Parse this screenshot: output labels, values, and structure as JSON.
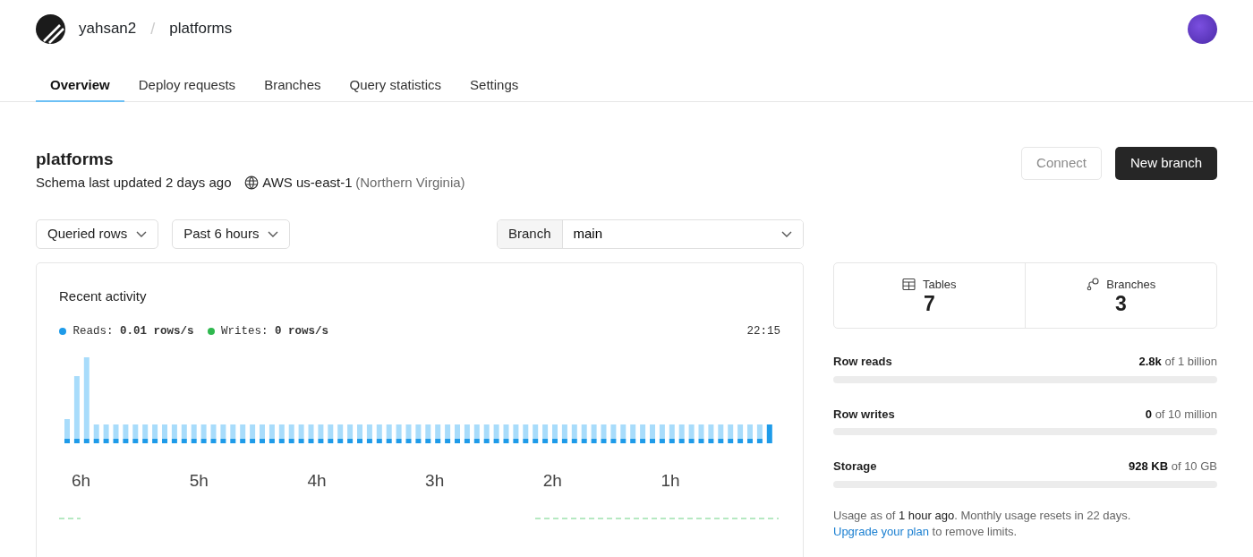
{
  "header": {
    "org": "yahsan2",
    "separator": "/",
    "database": "platforms"
  },
  "tabs": [
    {
      "label": "Overview",
      "selected": true
    },
    {
      "label": "Deploy requests",
      "selected": false
    },
    {
      "label": "Branches",
      "selected": false
    },
    {
      "label": "Query statistics",
      "selected": false
    },
    {
      "label": "Settings",
      "selected": false
    }
  ],
  "page": {
    "title": "platforms",
    "schema_updated": "Schema last updated 2 days ago",
    "region": "AWS us-east-1",
    "region_name": "(Northern Virginia)"
  },
  "actions": [
    {
      "label": "Connect",
      "kind": "secondary",
      "disabled": true
    },
    {
      "label": "New branch",
      "kind": "primary",
      "disabled": false
    }
  ],
  "filters": {
    "metric": "Queried rows",
    "range": "Past 6 hours",
    "branch_label": "Branch",
    "branch": "main"
  },
  "activity": {
    "title": "Recent activity",
    "time": "22:15",
    "legend": [
      {
        "text": "Reads: **0.01 rows/s**",
        "color": "#1e9be9"
      },
      {
        "text": "Writes: **0 rows/s**",
        "color": "#2fb84f"
      }
    ],
    "x_axis_labels": [
      "6h",
      "5h",
      "4h",
      "3h",
      "2h",
      "1h"
    ]
  },
  "stats": [
    {
      "label": "Tables",
      "value": "7",
      "kind": "tables"
    },
    {
      "label": "Branches",
      "value": "3",
      "kind": "branches"
    }
  ],
  "usage": [
    {
      "label": "Row reads",
      "amount": "**2.8k** of 1 billion",
      "level": 0
    },
    {
      "label": "Row writes",
      "amount": "**0** of 10 million",
      "level": 0
    },
    {
      "label": "Storage",
      "amount": "**928 KB** of 10 GB",
      "level": 0
    }
  ],
  "usage_note": {
    "text": "Usage as of **1 hour ago**. Monthly usage resets in 22 days.",
    "link": "Upgrade your plan",
    "after_link": "to remove limits."
  }
}
